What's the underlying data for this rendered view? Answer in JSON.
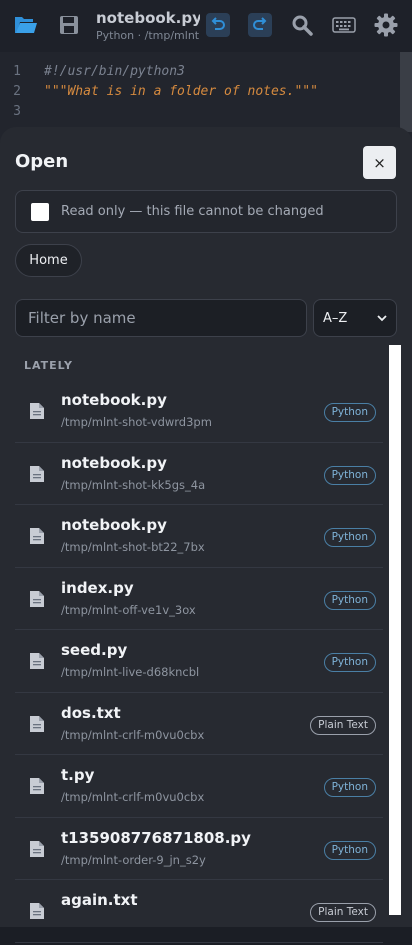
{
  "toolbar": {
    "title": "notebook.py",
    "subtitle": "Python · /tmp/mlnt"
  },
  "editor": {
    "line_numbers": [
      "1",
      "2",
      "3"
    ],
    "line1": "#!/usr/bin/python3",
    "line2": "\"\"\"What is in a folder of notes.\"\"\""
  },
  "sheet": {
    "title": "Open",
    "close_label": "×",
    "readonly_label": "Read only — this file cannot be changed",
    "home_label": "Home",
    "filter_placeholder": "Filter by name",
    "sort_value": "A–Z",
    "section_label": "LATELY"
  },
  "files": [
    {
      "name": "notebook.py",
      "path": "/tmp/mlnt-shot-vdwrd3pm",
      "badge": "Python"
    },
    {
      "name": "notebook.py",
      "path": "/tmp/mlnt-shot-kk5gs_4a",
      "badge": "Python"
    },
    {
      "name": "notebook.py",
      "path": "/tmp/mlnt-shot-bt22_7bx",
      "badge": "Python"
    },
    {
      "name": "index.py",
      "path": "/tmp/mlnt-off-ve1v_3ox",
      "badge": "Python"
    },
    {
      "name": "seed.py",
      "path": "/tmp/mlnt-live-d68kncbl",
      "badge": "Python"
    },
    {
      "name": "dos.txt",
      "path": "/tmp/mlnt-crlf-m0vu0cbx",
      "badge": "Plain Text"
    },
    {
      "name": "t.py",
      "path": "/tmp/mlnt-crlf-m0vu0cbx",
      "badge": "Python"
    },
    {
      "name": "t135908776871808.py",
      "path": "/tmp/mlnt-order-9_jn_s2y",
      "badge": "Python"
    },
    {
      "name": "again.txt",
      "path": "",
      "badge": "Plain Text"
    }
  ],
  "colors": {
    "accent_icon": "#2f8fd8",
    "python_badge": "#7fb3d8",
    "string": "#d58a3f"
  }
}
